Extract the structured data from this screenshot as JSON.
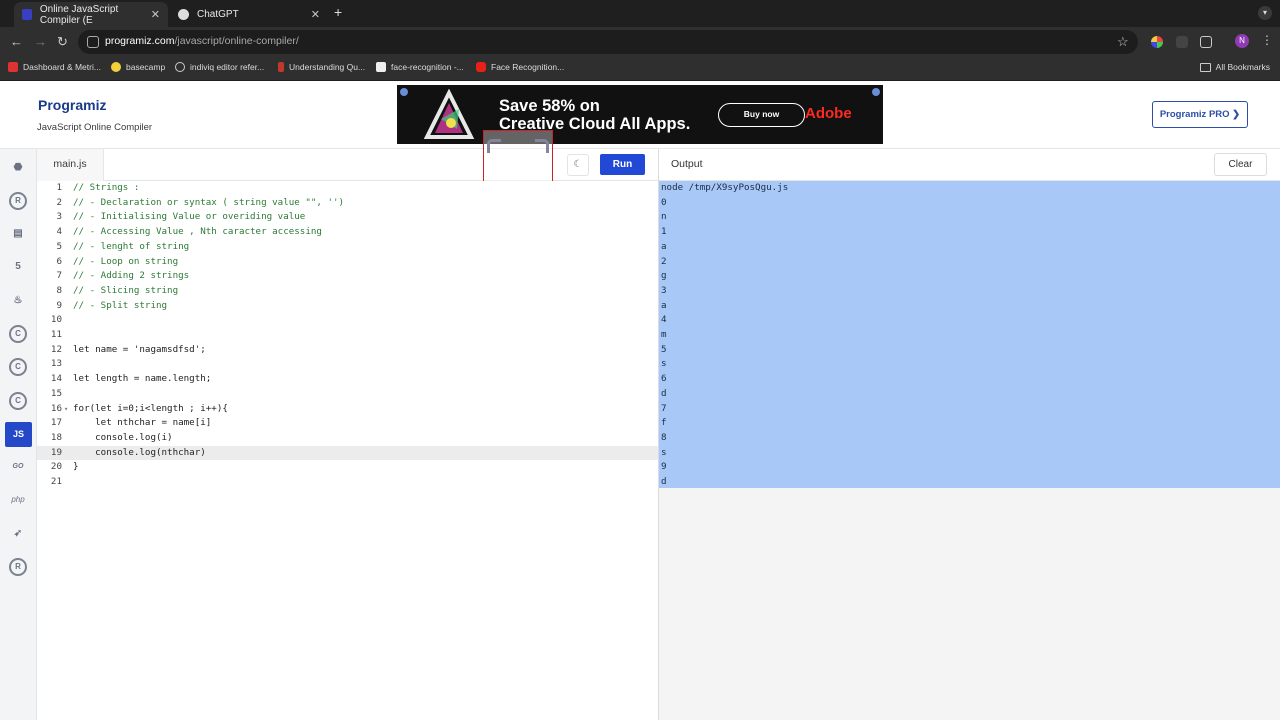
{
  "browser": {
    "tabs": [
      {
        "title": "Online JavaScript Compiler (E",
        "active": true
      },
      {
        "title": "ChatGPT",
        "active": false
      }
    ],
    "url_host": "programiz.com",
    "url_path": "/javascript/online-compiler/",
    "profile_initial": "N",
    "bookmarks": [
      "Dashboard & Metri...",
      "basecamp",
      "indiviq editor refer...",
      "Understanding Qu...",
      "face-recognition -...",
      "Face Recognition..."
    ],
    "all_bookmarks": "All Bookmarks"
  },
  "site": {
    "logo": "Programiz",
    "subtitle": "JavaScript Online Compiler",
    "ad": {
      "line1": "Save 58% on",
      "line2": "Creative Cloud All Apps.",
      "button": "Buy now",
      "brand": "Adobe"
    },
    "pro_button": "Programiz PRO ❯"
  },
  "editor": {
    "file_name": "main.js",
    "run_label": "Run",
    "theme_icon": "☾",
    "active_line": 19,
    "lines": [
      {
        "n": "1",
        "text": "// Strings :",
        "type": "comment"
      },
      {
        "n": "2",
        "text": "// - Declaration or syntax ( string value \"\", '')",
        "type": "comment"
      },
      {
        "n": "3",
        "text": "// - Initialising Value or overiding value",
        "type": "comment"
      },
      {
        "n": "4",
        "text": "// - Accessing Value , Nth caracter accessing",
        "type": "comment"
      },
      {
        "n": "5",
        "text": "// - lenght of string",
        "type": "comment"
      },
      {
        "n": "6",
        "text": "// - Loop on string",
        "type": "comment"
      },
      {
        "n": "7",
        "text": "// - Adding 2 strings",
        "type": "comment"
      },
      {
        "n": "8",
        "text": "// - Slicing string",
        "type": "comment"
      },
      {
        "n": "9",
        "text": "// - Split string",
        "type": "comment"
      },
      {
        "n": "10",
        "text": "",
        "type": "code"
      },
      {
        "n": "11",
        "text": "",
        "type": "code"
      },
      {
        "n": "12",
        "text": "let name = 'nagamsdfsd';",
        "type": "code"
      },
      {
        "n": "13",
        "text": "",
        "type": "code"
      },
      {
        "n": "14",
        "text": "let length = name.length;",
        "type": "code"
      },
      {
        "n": "15",
        "text": "",
        "type": "code"
      },
      {
        "n": "16",
        "text": "for(let i=0;i<length ; i++){",
        "type": "code"
      },
      {
        "n": "17",
        "text": "    let nthchar = name[i]",
        "type": "code"
      },
      {
        "n": "18",
        "text": "    console.log(i)",
        "type": "code"
      },
      {
        "n": "19",
        "text": "    console.log(nthchar)",
        "type": "code"
      },
      {
        "n": "20",
        "text": "}",
        "type": "code"
      },
      {
        "n": "21",
        "text": "",
        "type": "code"
      }
    ]
  },
  "output": {
    "title": "Output",
    "clear_label": "Clear",
    "lines": [
      "node /tmp/X9syPosQgu.js",
      "0",
      "n",
      "1",
      "a",
      "2",
      "g",
      "3",
      "a",
      "4",
      "m",
      "5",
      "s",
      "6",
      "d",
      "7",
      "f",
      "8",
      "s",
      "9",
      "d"
    ]
  },
  "sidebar": {
    "icons": [
      "python-icon",
      "r-icon",
      "sql-icon",
      "html-icon",
      "java-icon",
      "c-icon",
      "cpp-icon",
      "csharp-icon",
      "js-icon",
      "go-icon",
      "php-icon",
      "swift-icon",
      "rust-icon"
    ],
    "labels": [
      "",
      "R",
      "",
      "5",
      "",
      "C",
      "C",
      "C",
      "JS",
      "GO",
      "php",
      "",
      "R"
    ]
  }
}
